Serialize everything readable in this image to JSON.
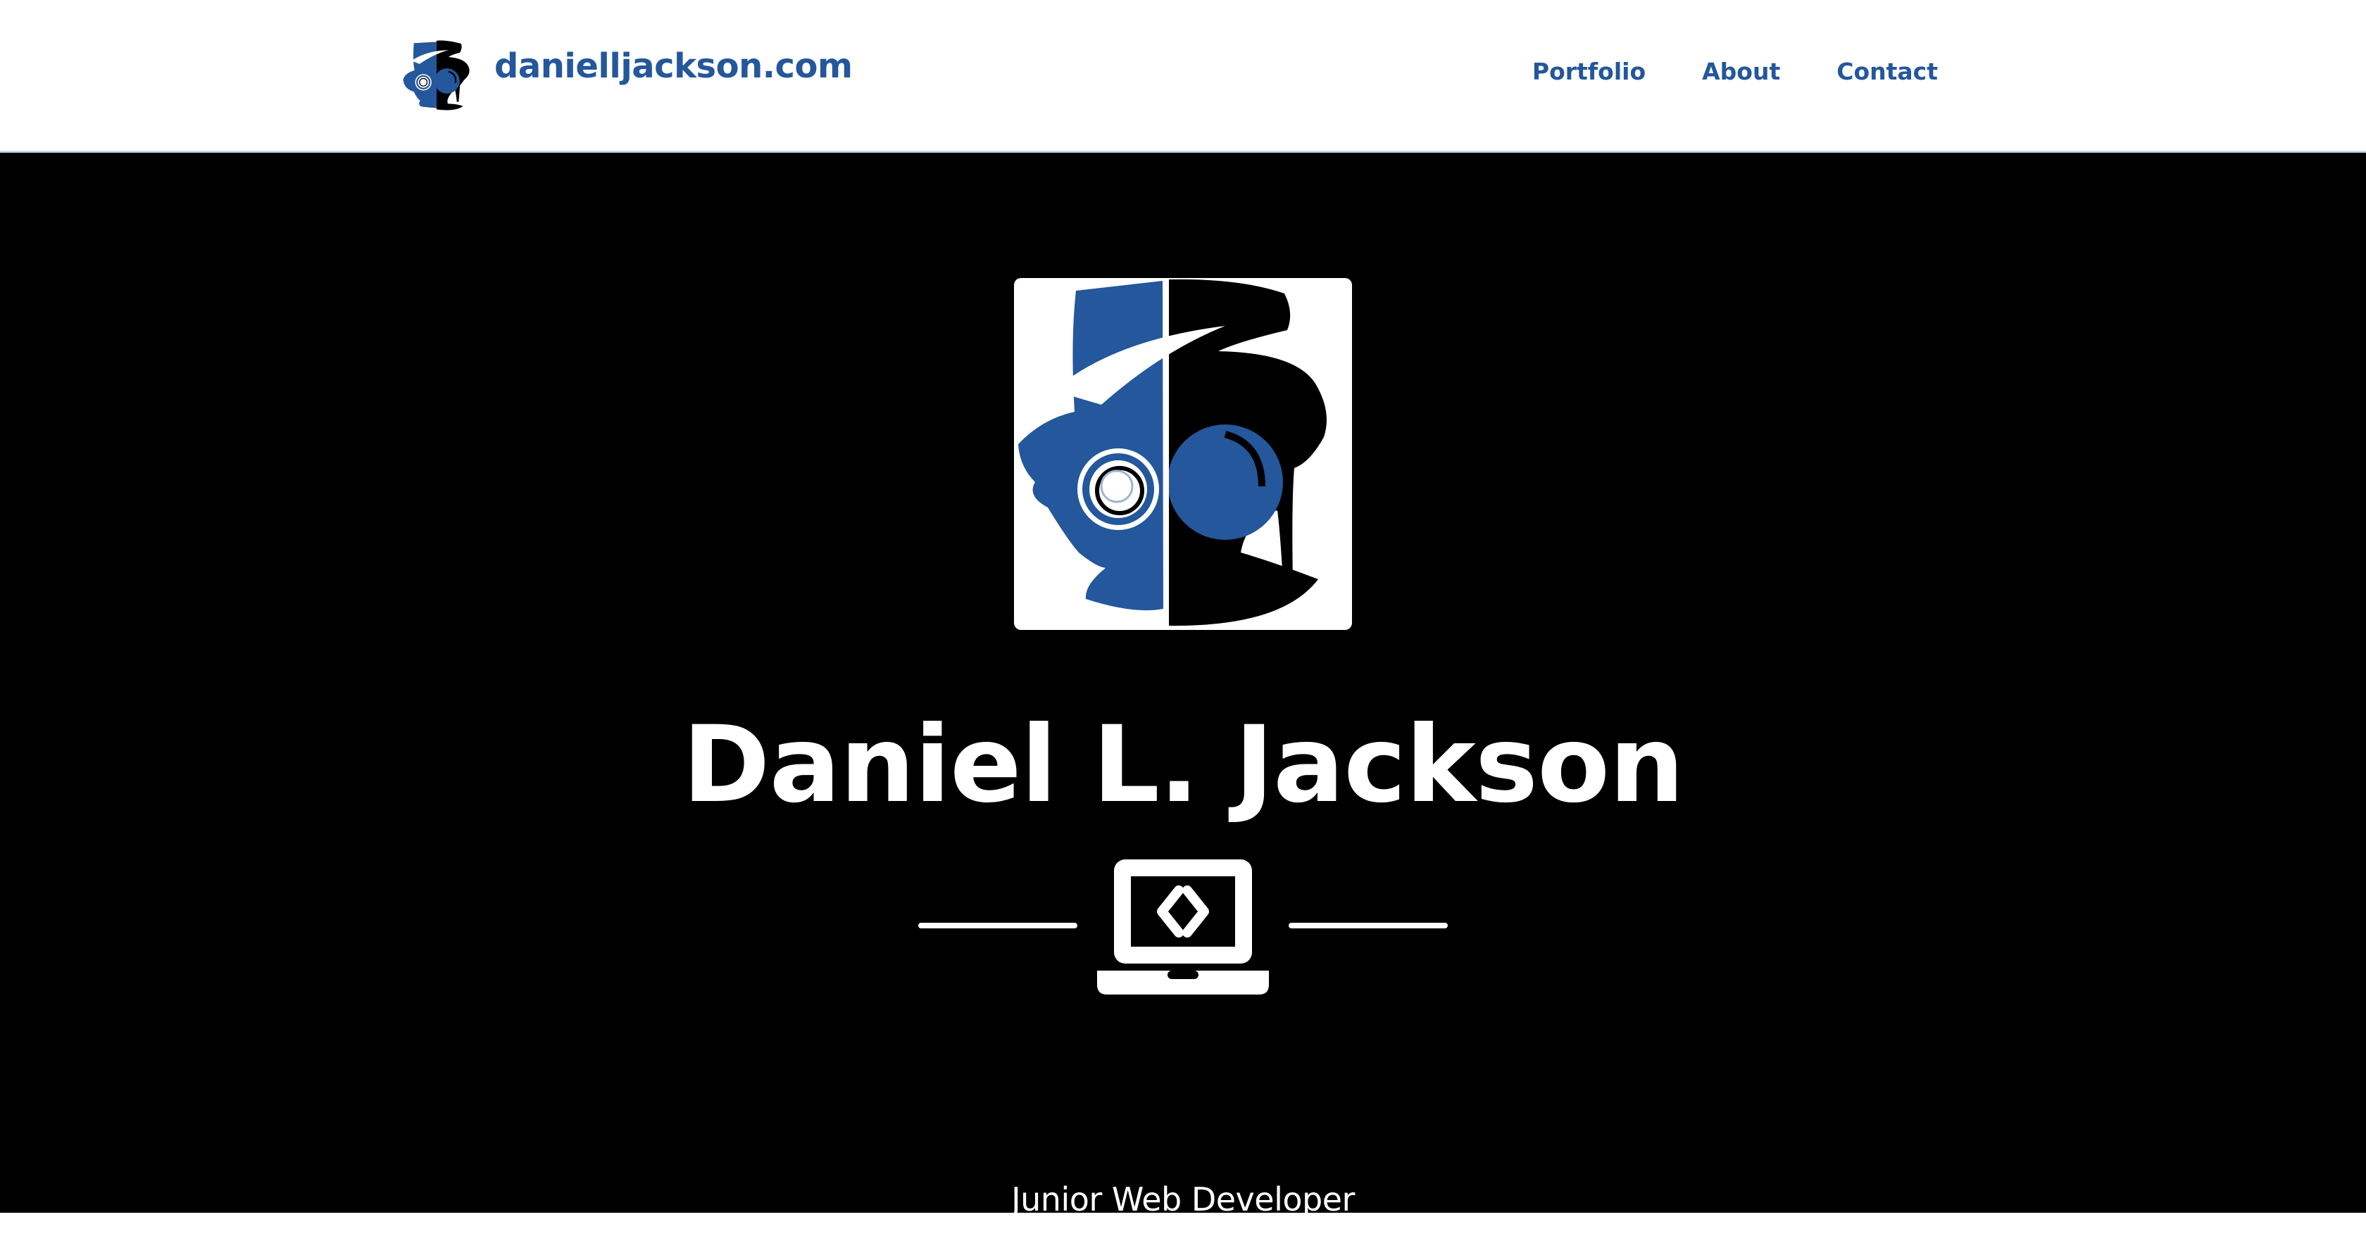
{
  "colors": {
    "brand_blue": "#24579b",
    "hero_bg": "#000000",
    "hero_text": "#ffffff",
    "nav_bg": "#ffffff"
  },
  "header": {
    "brand_text": "danielljackson.com",
    "brand_logo_icon": "top-hat-monocle-logo-icon",
    "nav": [
      {
        "label": "Portfolio"
      },
      {
        "label": "About"
      },
      {
        "label": "Contact"
      }
    ]
  },
  "hero": {
    "avatar_icon": "top-hat-monocle-avatar-icon",
    "name": "Daniel L. Jackson",
    "divider_icon": "laptop-code-icon",
    "subtitle": "Junior Web Developer"
  }
}
